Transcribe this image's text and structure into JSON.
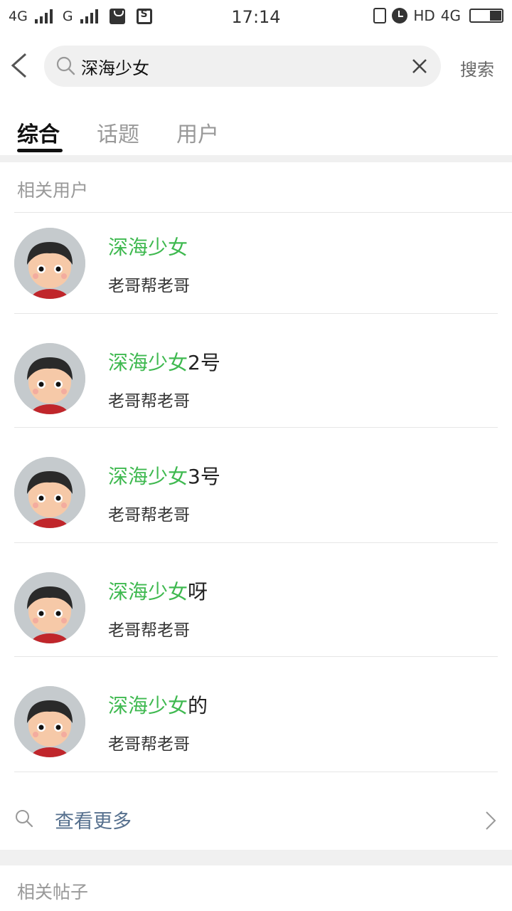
{
  "status_bar": {
    "net1": "4G",
    "net2": "G",
    "time": "17:14",
    "hd": "HD",
    "net3": "4G"
  },
  "search": {
    "query": "深海少女",
    "submit_label": "搜索"
  },
  "tabs": [
    {
      "label": "综合",
      "active": true
    },
    {
      "label": "话题",
      "active": false
    },
    {
      "label": "用户",
      "active": false
    }
  ],
  "related_users": {
    "title": "相关用户",
    "users": [
      {
        "name_highlight": "深海少女",
        "name_rest": "",
        "desc": "老哥帮老哥"
      },
      {
        "name_highlight": "深海少女",
        "name_rest": "2号",
        "desc": "老哥帮老哥"
      },
      {
        "name_highlight": "深海少女",
        "name_rest": "3号",
        "desc": "老哥帮老哥"
      },
      {
        "name_highlight": "深海少女",
        "name_rest": "呀",
        "desc": "老哥帮老哥"
      },
      {
        "name_highlight": "深海少女",
        "name_rest": "的",
        "desc": "老哥帮老哥"
      }
    ],
    "more_label": "查看更多"
  },
  "related_posts": {
    "title": "相关帖子"
  },
  "colors": {
    "highlight": "#3fb950",
    "link": "#56708e",
    "muted": "#999999"
  }
}
